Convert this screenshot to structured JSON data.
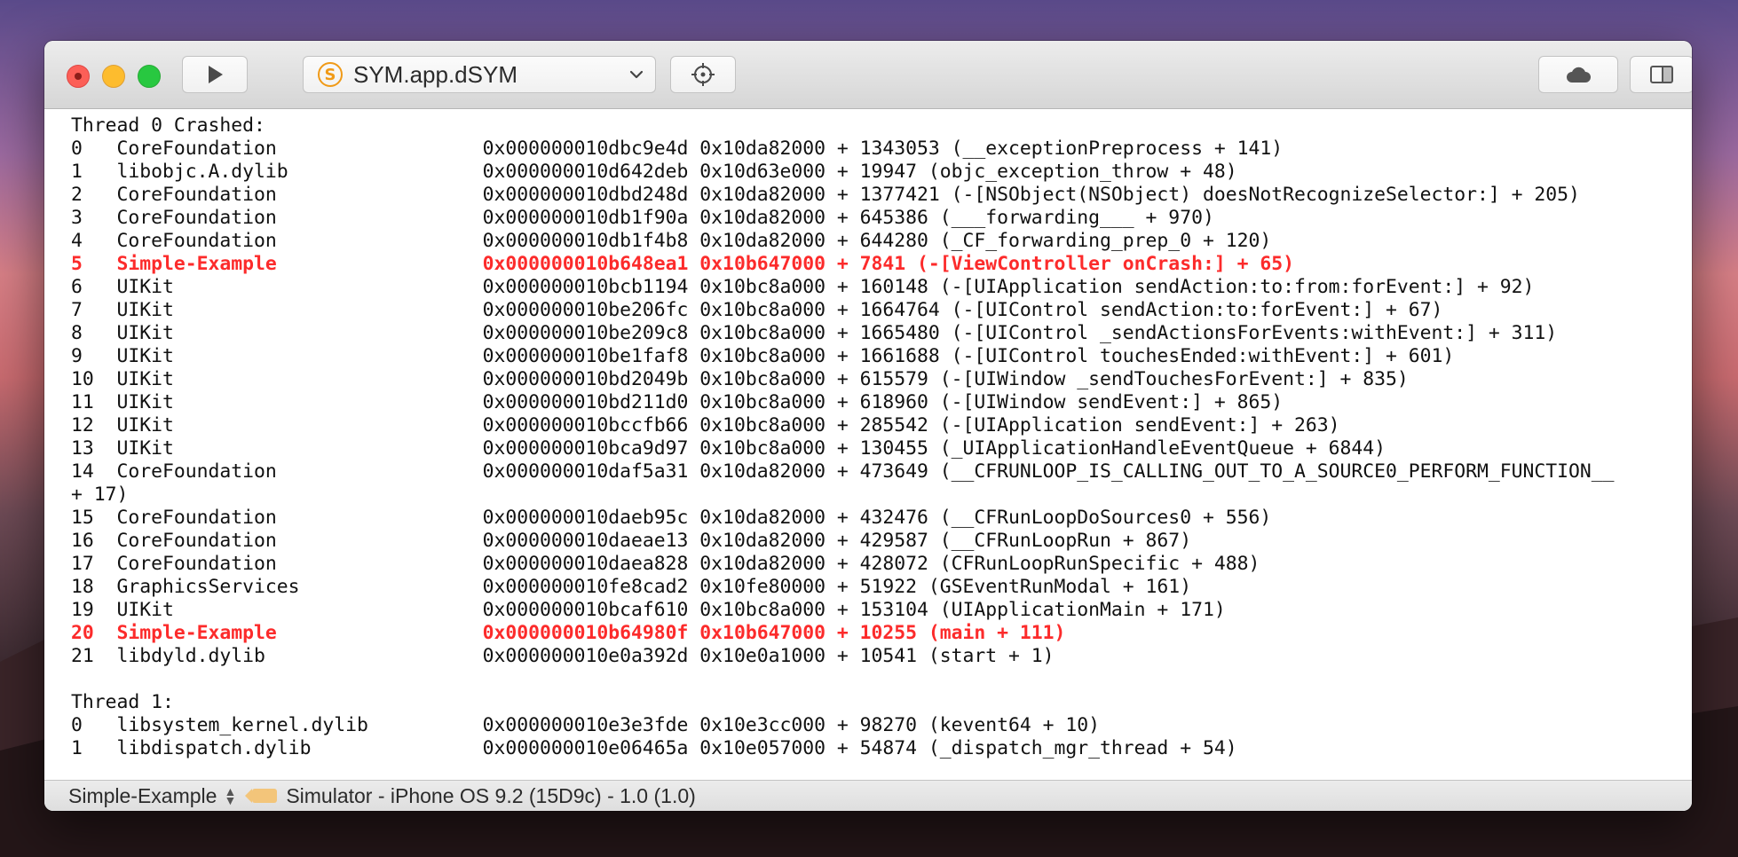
{
  "window": {
    "scheme_name": "SYM.app.dSYM",
    "scheme_icon_letter": "S"
  },
  "log": {
    "thread0_header": "Thread 0 Crashed:",
    "thread0_frames": [
      {
        "idx": "0",
        "lib": "CoreFoundation",
        "addr": "0x000000010dbc9e4d",
        "base": "0x10da82000",
        "offset": "1343053",
        "symbol": "(__exceptionPreprocess + 141)",
        "crash": false
      },
      {
        "idx": "1",
        "lib": "libobjc.A.dylib",
        "addr": "0x000000010d642deb",
        "base": "0x10d63e000",
        "offset": "19947",
        "symbol": "(objc_exception_throw + 48)",
        "crash": false
      },
      {
        "idx": "2",
        "lib": "CoreFoundation",
        "addr": "0x000000010dbd248d",
        "base": "0x10da82000",
        "offset": "1377421",
        "symbol": "(-[NSObject(NSObject) doesNotRecognizeSelector:] + 205)",
        "crash": false
      },
      {
        "idx": "3",
        "lib": "CoreFoundation",
        "addr": "0x000000010db1f90a",
        "base": "0x10da82000",
        "offset": "645386",
        "symbol": "(___forwarding___ + 970)",
        "crash": false
      },
      {
        "idx": "4",
        "lib": "CoreFoundation",
        "addr": "0x000000010db1f4b8",
        "base": "0x10da82000",
        "offset": "644280",
        "symbol": "(_CF_forwarding_prep_0 + 120)",
        "crash": false
      },
      {
        "idx": "5",
        "lib": "Simple-Example",
        "addr": "0x000000010b648ea1",
        "base": "0x10b647000",
        "offset": "7841",
        "symbol": "(-[ViewController onCrash:] + 65)",
        "crash": true
      },
      {
        "idx": "6",
        "lib": "UIKit",
        "addr": "0x000000010bcb1194",
        "base": "0x10bc8a000",
        "offset": "160148",
        "symbol": "(-[UIApplication sendAction:to:from:forEvent:] + 92)",
        "crash": false
      },
      {
        "idx": "7",
        "lib": "UIKit",
        "addr": "0x000000010be206fc",
        "base": "0x10bc8a000",
        "offset": "1664764",
        "symbol": "(-[UIControl sendAction:to:forEvent:] + 67)",
        "crash": false
      },
      {
        "idx": "8",
        "lib": "UIKit",
        "addr": "0x000000010be209c8",
        "base": "0x10bc8a000",
        "offset": "1665480",
        "symbol": "(-[UIControl _sendActionsForEvents:withEvent:] + 311)",
        "crash": false
      },
      {
        "idx": "9",
        "lib": "UIKit",
        "addr": "0x000000010be1faf8",
        "base": "0x10bc8a000",
        "offset": "1661688",
        "symbol": "(-[UIControl touchesEnded:withEvent:] + 601)",
        "crash": false
      },
      {
        "idx": "10",
        "lib": "UIKit",
        "addr": "0x000000010bd2049b",
        "base": "0x10bc8a000",
        "offset": "615579",
        "symbol": "(-[UIWindow _sendTouchesForEvent:] + 835)",
        "crash": false
      },
      {
        "idx": "11",
        "lib": "UIKit",
        "addr": "0x000000010bd211d0",
        "base": "0x10bc8a000",
        "offset": "618960",
        "symbol": "(-[UIWindow sendEvent:] + 865)",
        "crash": false
      },
      {
        "idx": "12",
        "lib": "UIKit",
        "addr": "0x000000010bccfb66",
        "base": "0x10bc8a000",
        "offset": "285542",
        "symbol": "(-[UIApplication sendEvent:] + 263)",
        "crash": false
      },
      {
        "idx": "13",
        "lib": "UIKit",
        "addr": "0x000000010bca9d97",
        "base": "0x10bc8a000",
        "offset": "130455",
        "symbol": "(_UIApplicationHandleEventQueue + 6844)",
        "crash": false
      },
      {
        "idx": "14",
        "lib": "CoreFoundation",
        "addr": "0x000000010daf5a31",
        "base": "0x10da82000",
        "offset": "473649",
        "symbol": "(__CFRUNLOOP_IS_CALLING_OUT_TO_A_SOURCE0_PERFORM_FUNCTION__\n+ 17)",
        "crash": false
      },
      {
        "idx": "15",
        "lib": "CoreFoundation",
        "addr": "0x000000010daeb95c",
        "base": "0x10da82000",
        "offset": "432476",
        "symbol": "(__CFRunLoopDoSources0 + 556)",
        "crash": false
      },
      {
        "idx": "16",
        "lib": "CoreFoundation",
        "addr": "0x000000010daeae13",
        "base": "0x10da82000",
        "offset": "429587",
        "symbol": "(__CFRunLoopRun + 867)",
        "crash": false
      },
      {
        "idx": "17",
        "lib": "CoreFoundation",
        "addr": "0x000000010daea828",
        "base": "0x10da82000",
        "offset": "428072",
        "symbol": "(CFRunLoopRunSpecific + 488)",
        "crash": false
      },
      {
        "idx": "18",
        "lib": "GraphicsServices",
        "addr": "0x000000010fe8cad2",
        "base": "0x10fe80000",
        "offset": "51922",
        "symbol": "(GSEventRunModal + 161)",
        "crash": false
      },
      {
        "idx": "19",
        "lib": "UIKit",
        "addr": "0x000000010bcaf610",
        "base": "0x10bc8a000",
        "offset": "153104",
        "symbol": "(UIApplicationMain + 171)",
        "crash": false
      },
      {
        "idx": "20",
        "lib": "Simple-Example",
        "addr": "0x000000010b64980f",
        "base": "0x10b647000",
        "offset": "10255",
        "symbol": "(main + 111)",
        "crash": true
      },
      {
        "idx": "21",
        "lib": "libdyld.dylib",
        "addr": "0x000000010e0a392d",
        "base": "0x10e0a1000",
        "offset": "10541",
        "symbol": "(start + 1)",
        "crash": false
      }
    ],
    "thread1_header": "Thread 1:",
    "thread1_frames": [
      {
        "idx": "0",
        "lib": "libsystem_kernel.dylib",
        "addr": "0x000000010e3e3fde",
        "base": "0x10e3cc000",
        "offset": "98270",
        "symbol": "(kevent64 + 10)",
        "crash": false
      },
      {
        "idx": "1",
        "lib": "libdispatch.dylib",
        "addr": "0x000000010e06465a",
        "base": "0x10e057000",
        "offset": "54874",
        "symbol": "(_dispatch_mgr_thread + 54)",
        "crash": false
      }
    ]
  },
  "statusbar": {
    "target": "Simple-Example",
    "device_info": "Simulator - iPhone OS 9.2 (15D9c) - 1.0 (1.0)"
  },
  "colors": {
    "crash_highlight": "#fc2b2b",
    "scheme_icon": "#f09a17"
  }
}
